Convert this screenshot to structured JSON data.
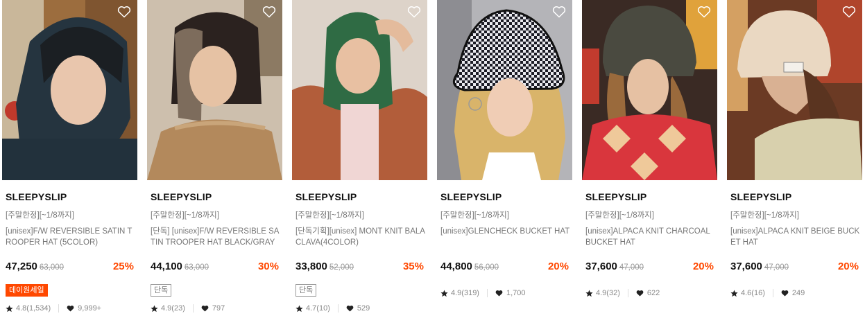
{
  "products": [
    {
      "brand": "SLEEPYSLIP",
      "tagline": "[주말한정][~1/8까지]",
      "name": "[unisex]F/W REVERSIBLE SATIN TROOPER HAT (5COLOR)",
      "price": "47,250",
      "original_price": "63,000",
      "discount": "25%",
      "badge": "데이원세일",
      "badge_type": "sale",
      "rating": "4.8(1,534)",
      "likes": "9,999+"
    },
    {
      "brand": "SLEEPYSLIP",
      "tagline": "[주말한정][~1/8까지]",
      "name": "[단독] [unisex]F/W REVERSIBLE SATIN TROOPER HAT BLACK/GRAY",
      "price": "44,100",
      "original_price": "63,000",
      "discount": "30%",
      "badge": "단독",
      "badge_type": "exclusive",
      "rating": "4.9(23)",
      "likes": "797"
    },
    {
      "brand": "SLEEPYSLIP",
      "tagline": "[주말한정][~1/8까지]",
      "name": "[단독기획][unisex] MONT KNIT BALACLAVA(4COLOR)",
      "price": "33,800",
      "original_price": "52,000",
      "discount": "35%",
      "badge": "단독",
      "badge_type": "exclusive",
      "rating": "4.7(10)",
      "likes": "529"
    },
    {
      "brand": "SLEEPYSLIP",
      "tagline": "[주말한정][~1/8까지]",
      "name": "[unisex]GLENCHECK BUCKET HAT",
      "price": "44,800",
      "original_price": "56,000",
      "discount": "20%",
      "badge": "",
      "badge_type": "none",
      "rating": "4.9(319)",
      "likes": "1,700"
    },
    {
      "brand": "SLEEPYSLIP",
      "tagline": "[주말한정][~1/8까지]",
      "name": "[unisex]ALPACA KNIT CHARCOAL BUCKET HAT",
      "price": "37,600",
      "original_price": "47,000",
      "discount": "20%",
      "badge": "",
      "badge_type": "none",
      "rating": "4.9(32)",
      "likes": "622"
    },
    {
      "brand": "SLEEPYSLIP",
      "tagline": "[주말한정][~1/8까지]",
      "name": "[unisex]ALPACA KNIT BEIGE BUCKET HAT",
      "price": "37,600",
      "original_price": "47,000",
      "discount": "20%",
      "badge": "",
      "badge_type": "none",
      "rating": "4.6(16)",
      "likes": "249"
    }
  ],
  "colors": {
    "discount": "#ff4800",
    "sale_badge": "#ff4800",
    "text": "#111111",
    "muted": "#777777"
  },
  "icons": {
    "wishlist": "heart-outline-icon",
    "rating": "star-icon",
    "likes": "heart-filled-icon"
  }
}
